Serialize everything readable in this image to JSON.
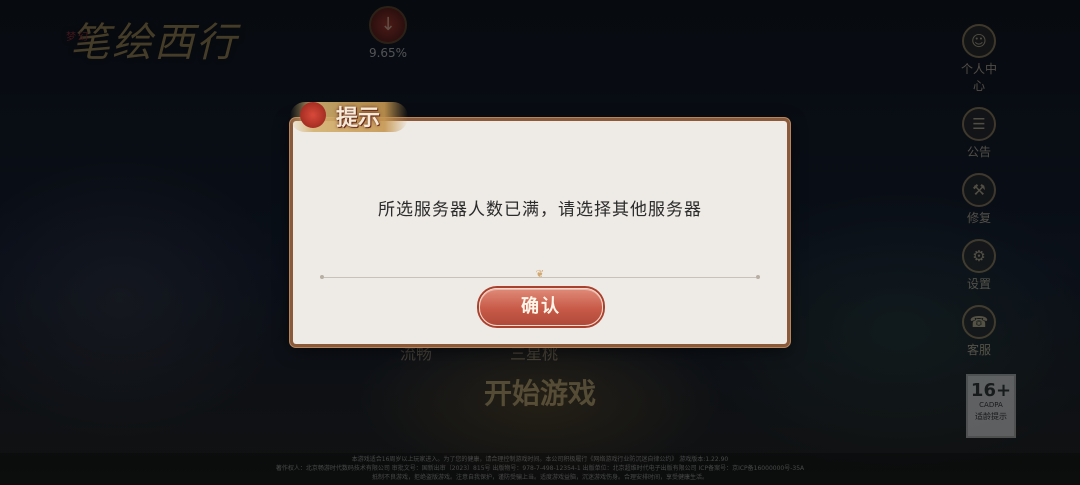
{
  "background": {
    "logo_text": "笔绘西行",
    "logo_prefix": "梦幻",
    "download_percent": "9.65%",
    "side_menu": [
      {
        "label": "个人中心",
        "icon": "user-icon"
      },
      {
        "label": "公告",
        "icon": "notice-icon"
      },
      {
        "label": "修复",
        "icon": "repair-icon"
      },
      {
        "label": "设置",
        "icon": "settings-icon"
      },
      {
        "label": "客服",
        "icon": "support-icon"
      }
    ],
    "server_row": {
      "left": "流畅",
      "right": "三星桃"
    },
    "start_label": "开始游戏",
    "rating": {
      "age": "16+",
      "org": "CADPA",
      "text": "适龄提示"
    },
    "footer_line1": "本游戏适合16周岁以上玩家进入。为了您的健康，请合理控制游戏时间。本公司积极履行《网络游戏行业防沉迷自律公约》 游戏版本:1.22.90",
    "footer_line2": "著作权人：北京畅游时代数码技术有限公司 审批文号：国新出审〔2023〕815号 出版物号：978-7-498-12354-1 出版单位：北京超维时代电子出版有限公司 ICP备案号：京ICP备16000000号-35A",
    "footer_line3": "抵制不良游戏，拒绝盗版游戏。注意自我保护，谨防受骗上当。适度游戏益脑，沉迷游戏伤身。合理安排时间，享受健康生活。"
  },
  "dialog": {
    "title": "提示",
    "message": "所选服务器人数已满，请选择其他服务器",
    "confirm_label": "确认"
  }
}
